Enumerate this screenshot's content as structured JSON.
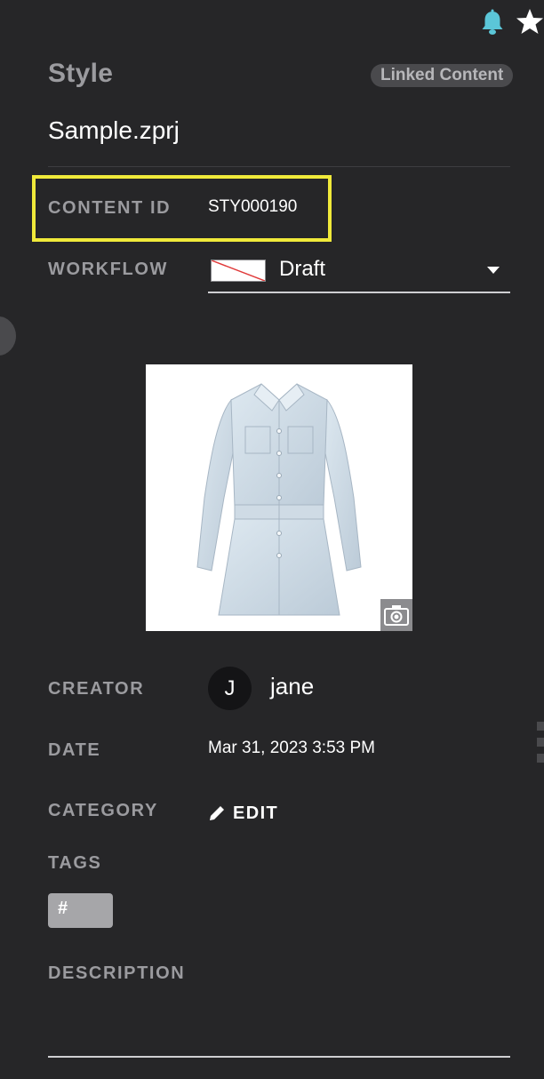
{
  "header": {
    "icons": [
      {
        "name": "bell-icon",
        "color": "#5bc6d8"
      },
      {
        "name": "star-icon",
        "color": "#ffffff"
      }
    ]
  },
  "panel": {
    "title": "Style",
    "linked_badge": "Linked Content",
    "filename": "Sample.zprj"
  },
  "fields": {
    "content_id": {
      "label": "CONTENT ID",
      "value": "STY000190"
    },
    "workflow": {
      "label": "WORKFLOW",
      "value": "Draft"
    },
    "creator": {
      "label": "CREATOR",
      "avatar_initial": "J",
      "name": "jane"
    },
    "date": {
      "label": "DATE",
      "value": "Mar 31, 2023 3:53 PM"
    },
    "category": {
      "label": "CATEGORY",
      "edit_label": "EDIT"
    },
    "tags": {
      "label": "TAGS",
      "chip": "#"
    },
    "description": {
      "label": "DESCRIPTION",
      "value": ""
    }
  },
  "thumbnail": {
    "subject": "denim-shirt-dress",
    "action_icon": "camera-icon"
  },
  "colors": {
    "background": "#262628",
    "label": "#9b9b9f",
    "highlight": "#f0e93a",
    "accent_bell": "#5bc6d8"
  }
}
